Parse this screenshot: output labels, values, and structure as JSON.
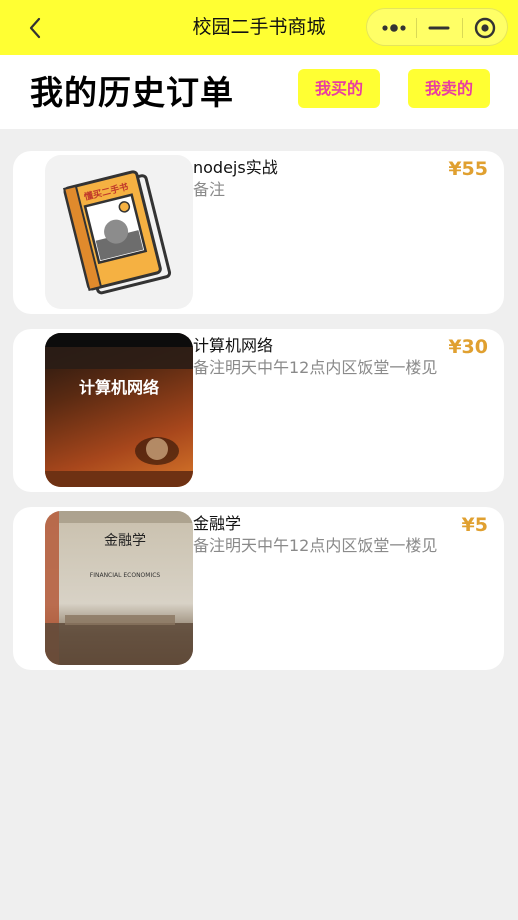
{
  "navbar": {
    "title": "校园二手书商城",
    "back_icon": "chevron-left-icon",
    "more_icon": "more-dots-icon",
    "minimize_icon": "minimize-icon",
    "close_icon": "target-circle-icon",
    "background": "#ffff33"
  },
  "header": {
    "title": "我的历史订单",
    "tabs": [
      {
        "label": "我买的"
      },
      {
        "label": "我卖的"
      }
    ],
    "tab_background": "#ffff33",
    "tab_text_color": "#e93ea0"
  },
  "orders": [
    {
      "name": "nodejs实战",
      "note": "备注",
      "price": "¥55",
      "thumb_label": "懂买二手书",
      "thumb_kind": "book-illustration"
    },
    {
      "name": "计算机网络",
      "note": "备注明天中午12点内区饭堂一楼见",
      "price": "¥30",
      "thumb_label": "计算机网络",
      "thumb_kind": "book-photo"
    },
    {
      "name": "金融学",
      "note": "备注明天中午12点内区饭堂一楼见",
      "price": "¥5",
      "thumb_label": "金融学",
      "thumb_sub": "FINANCIAL ECONOMICS",
      "thumb_kind": "book-photo"
    }
  ],
  "colors": {
    "price": "#e0a030",
    "page_bg": "#efefef"
  }
}
